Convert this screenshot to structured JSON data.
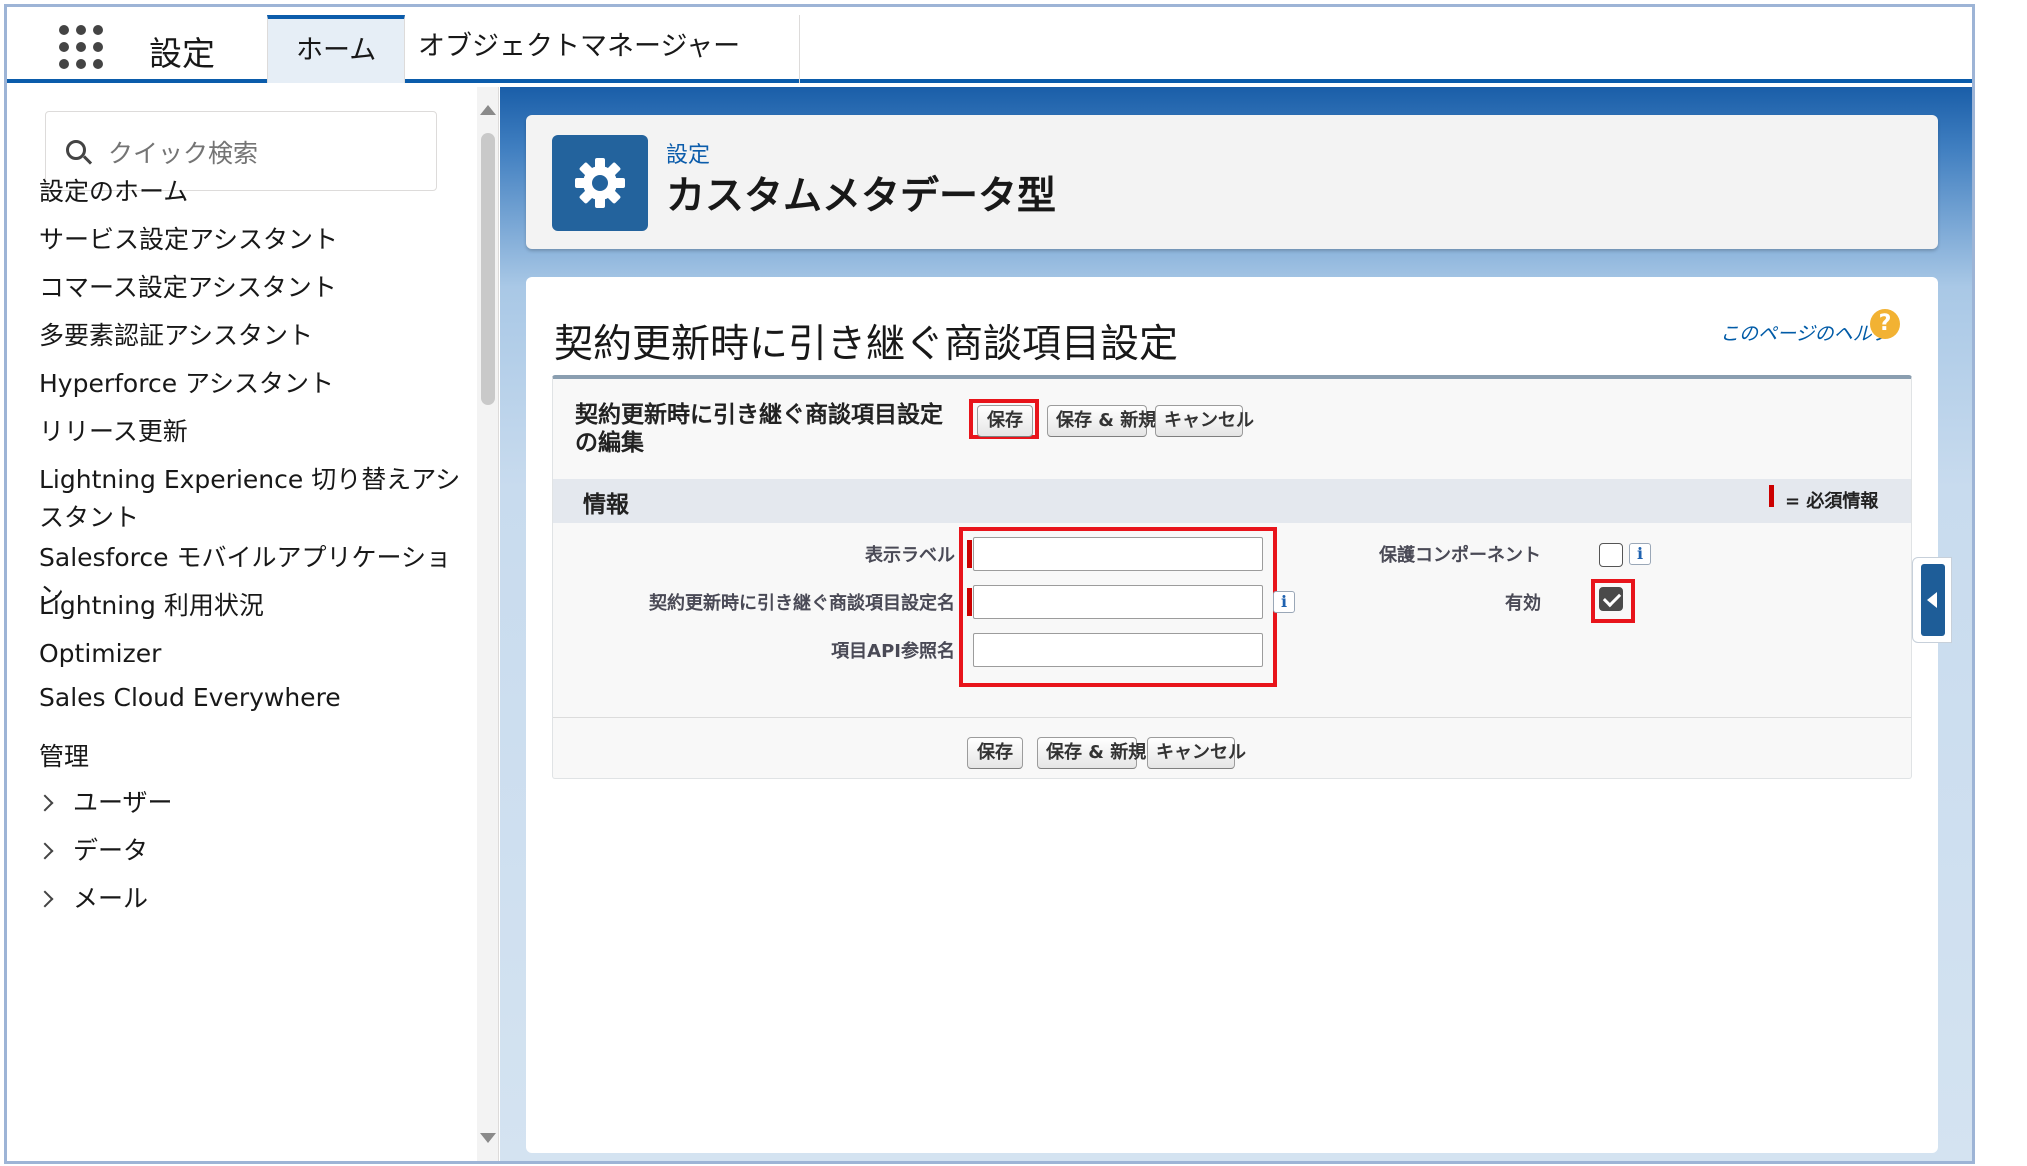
{
  "topbar": {
    "app_title": "設定",
    "tabs": [
      {
        "label": "ホーム"
      },
      {
        "label": "オブジェクトマネージャー"
      }
    ]
  },
  "sidebar": {
    "search_placeholder": "クイック検索",
    "items": [
      {
        "label": "設定のホーム"
      },
      {
        "label": "サービス設定アシスタント"
      },
      {
        "label": "コマース設定アシスタント"
      },
      {
        "label": "多要素認証アシスタント"
      },
      {
        "label": "Hyperforce アシスタント"
      },
      {
        "label": "リリース更新"
      },
      {
        "label": "Lightning Experience 切り替えアシスタント"
      },
      {
        "label": "Salesforce モバイルアプリケーション"
      },
      {
        "label": "Lightning 利用状況"
      },
      {
        "label": "Optimizer"
      },
      {
        "label": "Sales Cloud Everywhere"
      }
    ],
    "section_admin": "管理",
    "sub_items": [
      {
        "label": "ユーザー"
      },
      {
        "label": "データ"
      },
      {
        "label": "メール"
      }
    ]
  },
  "header": {
    "breadcrumb": "設定",
    "page_type": "カスタムメタデータ型"
  },
  "content": {
    "title": "契約更新時に引き継ぐ商談項目設定",
    "help_link": "このページのヘルプ",
    "help_icon": "?",
    "form_heading": "契約更新時に引き継ぐ商談項目設定の編集",
    "buttons": {
      "save": "保存",
      "save_new": "保存 & 新規",
      "cancel": "キャンセル"
    },
    "section_title": "情報",
    "required_note": "= 必須情報",
    "fields": {
      "label_label": "表示ラベル",
      "label_value": "",
      "name_label": "契約更新時に引き継ぐ商談項目設定名",
      "name_value": "",
      "api_label": "項目API参照名",
      "api_value": "",
      "protected_label": "保護コンポーネント",
      "protected_checked": false,
      "active_label": "有効",
      "active_checked": true
    },
    "info_glyph": "i"
  },
  "colors": {
    "brand": "#0b5cab",
    "highlight": "#e8141b",
    "required": "#cc0000",
    "gear_tile": "#23639d"
  }
}
